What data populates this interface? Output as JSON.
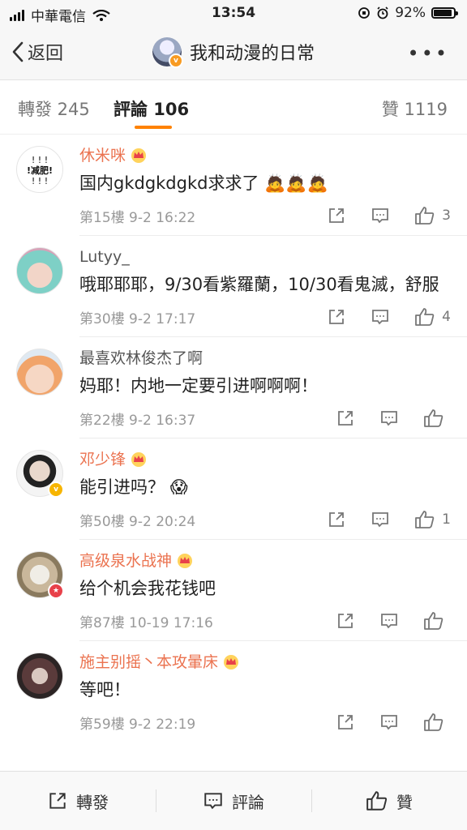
{
  "status": {
    "carrier": "中華電信",
    "time": "13:54",
    "battery": "92%",
    "battery_level": 0.92
  },
  "nav": {
    "back_label": "返回",
    "title": "我和动漫的日常"
  },
  "tabs": {
    "repost": "轉發 245",
    "comment": "評論 106",
    "like": "贊 1119"
  },
  "comments": [
    {
      "name": "休米咪",
      "crown": true,
      "text": "国内gkdgkdgkd求求了",
      "emoji": "🙇🙇🙇",
      "floor": "第15樓 9-2 16:22",
      "likes": "3"
    },
    {
      "name": "Lutyy_",
      "crown": false,
      "text": "哦耶耶耶，9/30看紫羅蘭，10/30看鬼滅，舒服",
      "emoji": "",
      "floor": "第30樓 9-2 17:17",
      "likes": "4"
    },
    {
      "name": "最喜欢林俊杰了啊",
      "crown": false,
      "text": "妈耶！内地一定要引进啊啊啊！",
      "emoji": "",
      "floor": "第22樓 9-2 16:37",
      "likes": ""
    },
    {
      "name": "邓少锋",
      "crown": true,
      "text": "能引进吗？",
      "emoji": "😱",
      "floor": "第50樓 9-2 20:24",
      "likes": "1"
    },
    {
      "name": "高级泉水战神",
      "crown": true,
      "text": "给个机会我花钱吧",
      "emoji": "",
      "floor": "第87樓 10-19 17:16",
      "likes": ""
    },
    {
      "name": "施主别摇丶本攻暈床",
      "crown": true,
      "text": "等吧！",
      "emoji": "",
      "floor": "第59樓 9-2 22:19",
      "likes": ""
    }
  ],
  "bottom": {
    "repost": "轉發",
    "comment": "評論",
    "like": "贊"
  },
  "colors": {
    "accent": "#ff8200",
    "username": "#eb7350"
  }
}
